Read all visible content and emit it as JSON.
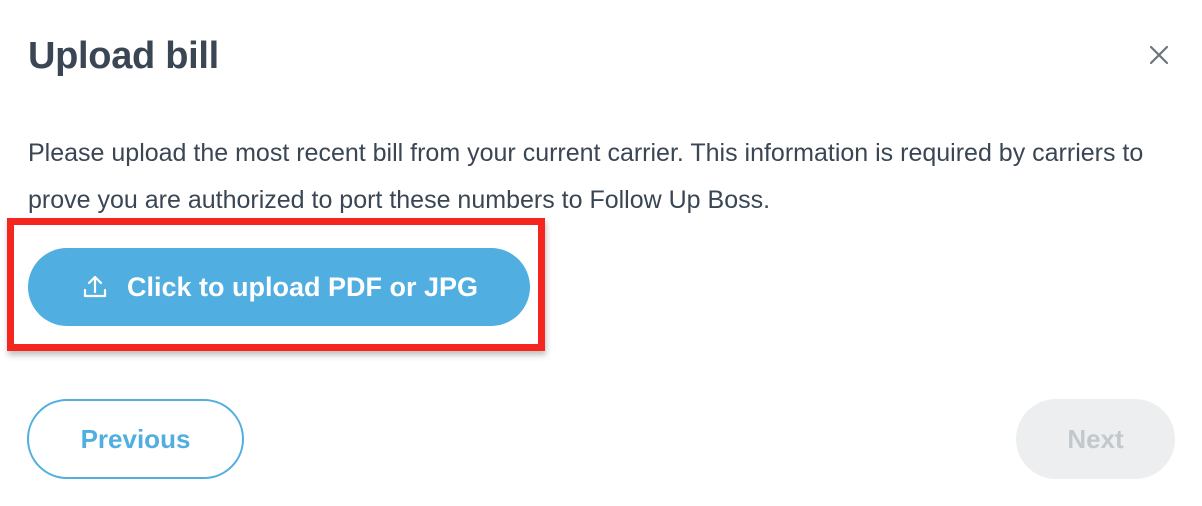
{
  "dialog": {
    "title": "Upload bill",
    "close_icon": "close-icon",
    "description": "Please upload the most recent bill from your current carrier. This information is required by carriers to prove you are authorized to port these numbers to Follow Up Boss."
  },
  "upload": {
    "icon": "upload-icon",
    "label": "Click to upload PDF or JPG"
  },
  "footer": {
    "previous_label": "Previous",
    "next_label": "Next"
  },
  "colors": {
    "accent": "#50aee1",
    "text": "#3a4654",
    "highlight": "#f5261d",
    "disabled_bg": "#eceef0",
    "disabled_text": "#c3c8cd"
  }
}
